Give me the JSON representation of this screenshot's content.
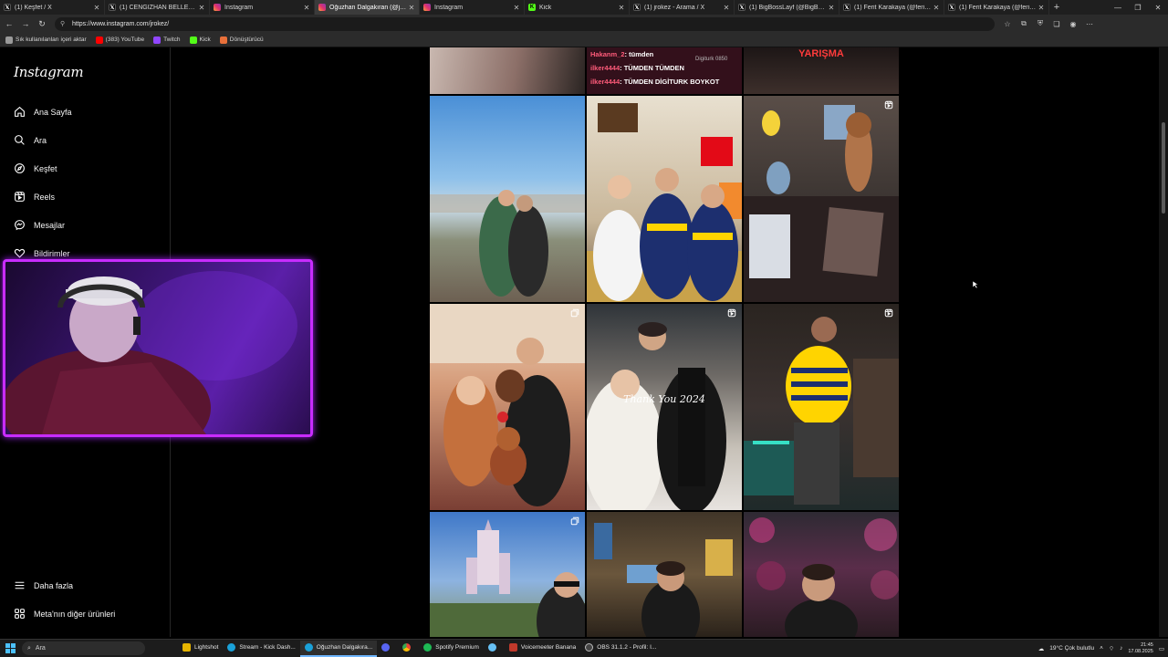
{
  "browser": {
    "tabs": [
      {
        "label": "(1) Keşfet / X",
        "icon": "x-logo-icon"
      },
      {
        "label": "(1) CENGİZHAN BELLER (@cengizhanbeller)",
        "icon": "x-logo-icon"
      },
      {
        "label": "Instagram",
        "icon": "instagram-icon"
      },
      {
        "label": "Oğuzhan Dalgakıran (@jrokez)",
        "icon": "instagram-icon",
        "active": true
      },
      {
        "label": "Instagram",
        "icon": "instagram-icon"
      },
      {
        "label": "Kick",
        "icon": "kick-icon"
      },
      {
        "label": "(1) jrokez - Arama / X",
        "icon": "x-logo-icon"
      },
      {
        "label": "(1) BigBossLayf (@BigBossLayf)",
        "icon": "x-logo-icon"
      },
      {
        "label": "(1) Ferit Karakaya (@feritkw) / X",
        "icon": "x-logo-icon"
      },
      {
        "label": "(1) Ferit Karakaya (@feritkw) / X",
        "icon": "x-logo-icon"
      }
    ],
    "url": "https://www.instagram.com/jrokez/",
    "bookmarks": [
      {
        "label": "Sık kullanılanları içeri aktar",
        "color": "#9a9a9a"
      },
      {
        "label": "(383) YouTube",
        "color": "#ff0000"
      },
      {
        "label": "Twitch",
        "color": "#9146ff"
      },
      {
        "label": "Kick",
        "color": "#53fc18"
      },
      {
        "label": "Dönüştürücü",
        "color": "#e8703a"
      }
    ]
  },
  "instagram": {
    "logo": "Instagram",
    "nav": [
      {
        "label": "Ana Sayfa",
        "icon": "home-icon"
      },
      {
        "label": "Ara",
        "icon": "search-icon"
      },
      {
        "label": "Keşfet",
        "icon": "compass-icon"
      },
      {
        "label": "Reels",
        "icon": "reels-icon"
      },
      {
        "label": "Mesajlar",
        "icon": "messenger-icon"
      },
      {
        "label": "Bildirimler",
        "icon": "heart-icon"
      }
    ],
    "bottom_nav": [
      {
        "label": "Daha fazla",
        "icon": "menu-icon"
      },
      {
        "label": "Meta'nın diğer ürünleri",
        "icon": "meta-apps-icon"
      }
    ],
    "posts_top_overlay": {
      "chat_lines": [
        {
          "user": "Hakanm_2",
          "text": ": tümden"
        },
        {
          "user": "ilker4444",
          "text": ": TÜMDEN TÜMDEN"
        },
        {
          "user": "ilker4444",
          "text": ": TÜMDEN DİGİTURK BOYKOT"
        }
      ],
      "brand_text": "Digiturk 0850",
      "sign_text": "YARIŞMA"
    },
    "posts": [
      {
        "caption": "",
        "type": "photo"
      },
      {
        "caption": "",
        "type": "photo"
      },
      {
        "caption": "",
        "type": "reel"
      },
      {
        "caption": "",
        "type": "photo"
      },
      {
        "caption": "Thank You 2024",
        "type": "reel"
      },
      {
        "caption": "",
        "type": "reel"
      },
      {
        "caption": "",
        "type": "carousel"
      },
      {
        "caption": "",
        "type": "photo"
      },
      {
        "caption": "",
        "type": "photo"
      }
    ]
  },
  "taskbar": {
    "search_placeholder": "Ara",
    "apps": [
      {
        "label": "Lightshot",
        "color": "#e6b400"
      },
      {
        "label": "Stream - Kick Dash...",
        "color": "#1aa1d9"
      },
      {
        "label": "Oğuzhan Dalgakıra...",
        "color": "#1aa1d9",
        "active": true
      },
      {
        "label": "",
        "color": "#5865f2"
      },
      {
        "label": "",
        "color": "#f4b400"
      },
      {
        "label": "Spotify Premium",
        "color": "#1db954"
      },
      {
        "label": "",
        "color": "#66c0f4"
      },
      {
        "label": "Voicemeeter Banana",
        "color": "#c0392b"
      },
      {
        "label": "OBS 31.1.2 - Profil: I...",
        "color": "#444444"
      }
    ],
    "weather": "19°C  Çok bulutlu",
    "time": "21:45",
    "date": "17.08.2025"
  }
}
